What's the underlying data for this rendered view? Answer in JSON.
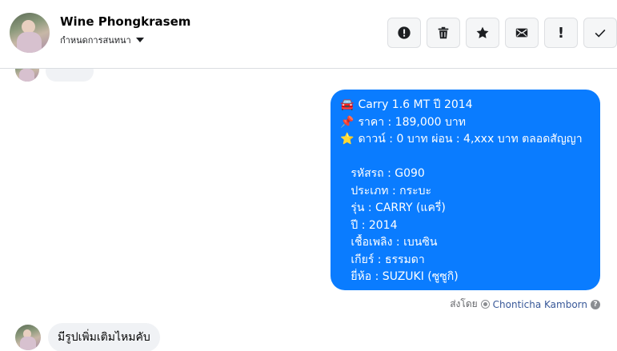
{
  "header": {
    "contact_name": "Wine Phongkrasem",
    "settings_label": "กำหนดการสนทนา",
    "toolbar": [
      {
        "name": "report-button",
        "icon": "alert-circle-icon",
        "glyph": ""
      },
      {
        "name": "delete-button",
        "icon": "trash-icon",
        "glyph": ""
      },
      {
        "name": "star-button",
        "icon": "star-icon",
        "glyph": ""
      },
      {
        "name": "mark-unread-button",
        "icon": "envelope-icon",
        "glyph": ""
      },
      {
        "name": "important-button",
        "icon": "exclamation-icon",
        "glyph": "!"
      },
      {
        "name": "done-button",
        "icon": "checkmark-icon",
        "glyph": ""
      }
    ]
  },
  "outgoing_message": {
    "lines": [
      {
        "emoji": "🚘",
        "text": "Carry 1.6 MT ปี 2014"
      },
      {
        "emoji": "📌",
        "text": "ราคา : 189,000 บาท"
      },
      {
        "emoji": "⭐",
        "text": "ดาวน์ : 0 บาท ผ่อน : 4,xxx บาท ตลอดสัญญา"
      },
      {
        "emoji": "",
        "text": ""
      },
      {
        "emoji": "",
        "text": "   รหัสรถ : G090"
      },
      {
        "emoji": "",
        "text": "   ประเภท : กระบะ"
      },
      {
        "emoji": "",
        "text": "   รุ่น : CARRY (แครี่)"
      },
      {
        "emoji": "",
        "text": "   ปี : 2014"
      },
      {
        "emoji": "",
        "text": "   เชื้อเพลิง : เบนซิน"
      },
      {
        "emoji": "",
        "text": "   เกียร์ : ธรรมดา"
      },
      {
        "emoji": "",
        "text": "   ยี่ห้อ : SUZUKI (ซูซูกิ)"
      }
    ],
    "sent_by_label": "ส่งโดย",
    "sender_name": "Chonticha Kamborn",
    "accent_color": "#0a7cff"
  },
  "incoming_message": {
    "text": "มีรูปเพิ่มเติมไหมคับ"
  }
}
